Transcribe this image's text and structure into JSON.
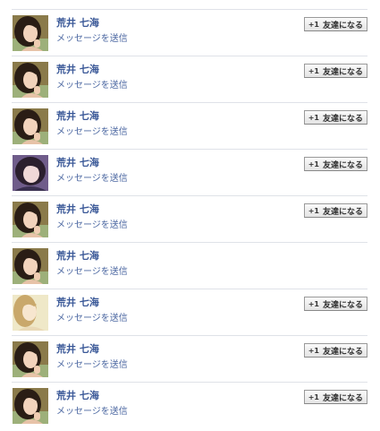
{
  "rows": [
    {
      "name": "荒井 七海",
      "message_label": "メッセージを送信",
      "button": {
        "icon": "+1",
        "label": "友達になる"
      },
      "avatar": "photo-a"
    },
    {
      "name": "荒井 七海",
      "message_label": "メッセージを送信",
      "button": {
        "icon": "+1",
        "label": "友達になる"
      },
      "avatar": "photo-a"
    },
    {
      "name": "荒井 七海",
      "message_label": "メッセージを送信",
      "button": {
        "icon": "+1",
        "label": "友達になる"
      },
      "avatar": "photo-a"
    },
    {
      "name": "荒井 七海",
      "message_label": "メッセージを送信",
      "button": {
        "icon": "+1",
        "label": "友達になる"
      },
      "avatar": "photo-b"
    },
    {
      "name": "荒井 七海",
      "message_label": "メッセージを送信",
      "button": {
        "icon": "+1",
        "label": "友達になる"
      },
      "avatar": "photo-a"
    },
    {
      "name": "荒井 七海",
      "message_label": "メッセージを送信",
      "button": null,
      "avatar": "photo-a"
    },
    {
      "name": "荒井 七海",
      "message_label": "メッセージを送信",
      "button": {
        "icon": "+1",
        "label": "友達になる"
      },
      "avatar": "photo-c"
    },
    {
      "name": "荒井 七海",
      "message_label": "メッセージを送信",
      "button": {
        "icon": "+1",
        "label": "友達になる"
      },
      "avatar": "photo-a"
    },
    {
      "name": "荒井 七海",
      "message_label": "メッセージを送信",
      "button": {
        "icon": "+1",
        "label": "友達になる"
      },
      "avatar": "photo-a"
    }
  ],
  "colors": {
    "link": "#3b5998",
    "divider": "#dfe2e8"
  }
}
